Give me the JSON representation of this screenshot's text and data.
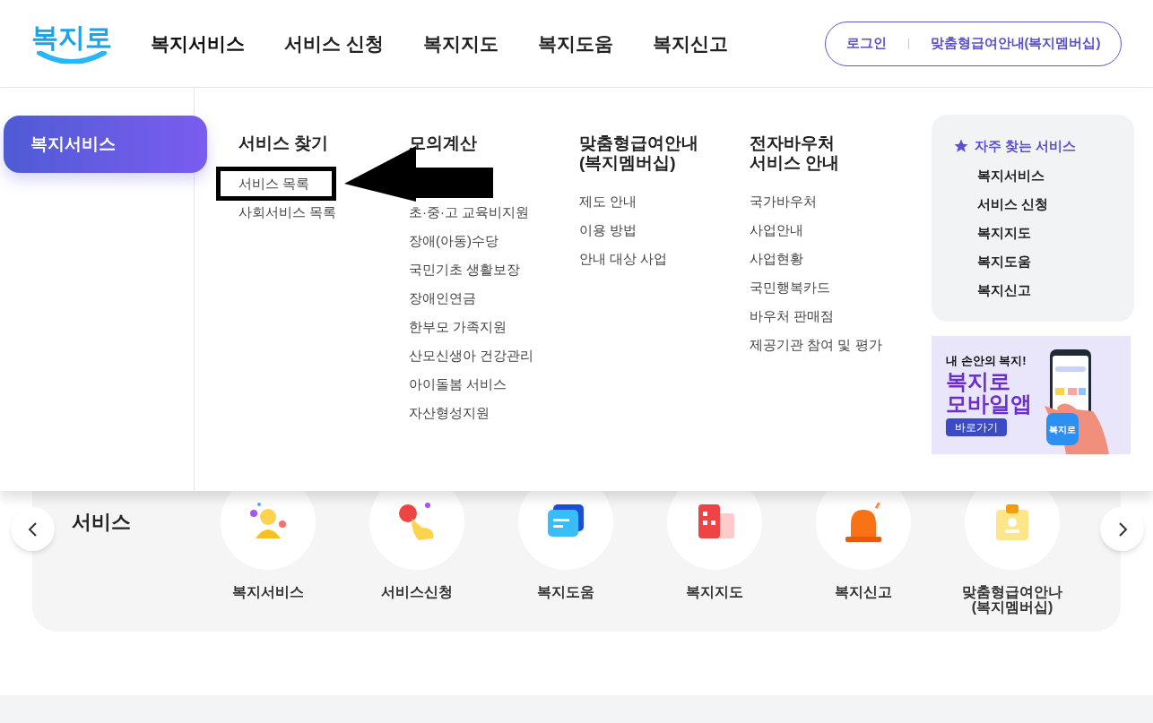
{
  "header": {
    "logo": "복지로",
    "nav": [
      {
        "label": "복지서비스",
        "selected": true
      },
      {
        "label": "서비스 신청",
        "selected": false
      },
      {
        "label": "복지지도",
        "selected": false
      },
      {
        "label": "복지도움",
        "selected": false
      },
      {
        "label": "복지신고",
        "selected": false
      }
    ],
    "login": "로그인",
    "membership": "맞춤형급여안내(복지멤버십)"
  },
  "menu": {
    "category": {
      "label": "복지서비스",
      "selected": true
    },
    "columns": [
      {
        "title": [
          "서비스 찾기"
        ],
        "items": [
          {
            "label": "서비스 목록",
            "marked": true
          },
          {
            "label": "사회서비스 목록",
            "marked": false
          }
        ]
      },
      {
        "title": [
          "모의계산"
        ],
        "items": [
          {
            "label": "초·중·고 교육비지원",
            "marked": false
          },
          {
            "label": "장애(아동)수당",
            "marked": false
          },
          {
            "label": "국민기초 생활보장",
            "marked": false
          },
          {
            "label": "장애인연금",
            "marked": false
          },
          {
            "label": "한부모 가족지원",
            "marked": false
          },
          {
            "label": "산모신생아 건강관리",
            "marked": false
          },
          {
            "label": "아이돌봄 서비스",
            "marked": false
          },
          {
            "label": "자산형성지원",
            "marked": false
          }
        ]
      },
      {
        "title": [
          "맞춤형급여안내",
          "(복지멤버십)"
        ],
        "items": [
          {
            "label": "제도 안내",
            "marked": false
          },
          {
            "label": "이용 방법",
            "marked": false
          },
          {
            "label": "안내 대상 사업",
            "marked": false
          }
        ]
      },
      {
        "title": [
          "전자바우처",
          "서비스 안내"
        ],
        "items": [
          {
            "label": "국가바우처",
            "marked": false
          },
          {
            "label": "사업안내",
            "marked": false
          },
          {
            "label": "사업현황",
            "marked": false
          },
          {
            "label": "국민행복카드",
            "marked": false
          },
          {
            "label": "바우처 판매점",
            "marked": false
          },
          {
            "label": "제공기관 참여 및 평가",
            "marked": false
          }
        ]
      }
    ],
    "favorites": {
      "title": "자주 찾는 서비스",
      "items": [
        "복지서비스",
        "서비스 신청",
        "복지지도",
        "복지도움",
        "복지신고"
      ]
    },
    "banner": {
      "tagline": "내 손안의 복지!",
      "title": [
        "복지로",
        "모바일앱"
      ],
      "button": "바로가기",
      "app_icon": "복지로"
    }
  },
  "carousel": {
    "heading": "서비스",
    "items": [
      {
        "kind": "person",
        "label": [
          "복지서비스"
        ]
      },
      {
        "kind": "hand",
        "label": [
          "서비스신청"
        ]
      },
      {
        "kind": "chat",
        "label": [
          "복지도움"
        ]
      },
      {
        "kind": "map",
        "label": [
          "복지지도"
        ]
      },
      {
        "kind": "siren",
        "label": [
          "복지신고"
        ]
      },
      {
        "kind": "clipboard",
        "label": [
          "맞춤형급여안나",
          "(복지멤버십)"
        ]
      }
    ]
  }
}
